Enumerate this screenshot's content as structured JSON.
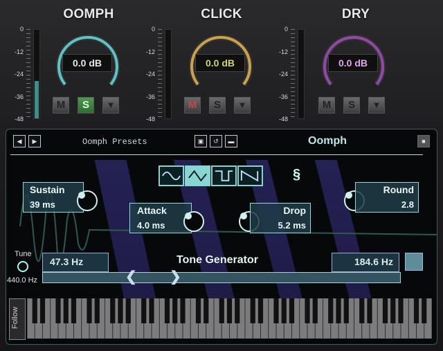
{
  "strips": [
    {
      "title": "OOMPH",
      "db": "0.0 dB",
      "db_color": "#e8e8e8",
      "arc_color": "#5bc4c4",
      "meter_level": 0.42,
      "buttons": {
        "m": "M",
        "s": "S",
        "arrow": "▼"
      },
      "m_state": "off",
      "s_state": "on"
    },
    {
      "title": "CLICK",
      "db": "0.0 dB",
      "db_color": "#d3d36c",
      "arc_color": "#c9a24b",
      "meter_level": 0,
      "buttons": {
        "m": "M",
        "s": "S",
        "arrow": "▼"
      },
      "m_state": "red",
      "s_state": "off"
    },
    {
      "title": "DRY",
      "db": "0.0 dB",
      "db_color": "#e2a8e6",
      "arc_color": "#9348a7",
      "meter_level": 0,
      "buttons": {
        "m": "M",
        "s": "S",
        "arrow": "▼"
      },
      "m_state": "off",
      "s_state": "off"
    }
  ],
  "meter_scale": [
    "0",
    "-12",
    "-24",
    "-36",
    "-48"
  ],
  "header": {
    "prev_icon": "triangle-left-icon",
    "next_icon": "triangle-right-icon",
    "preset_label": "Oomph Presets",
    "save_icon": "save-icon",
    "reset_icon": "reset-icon",
    "folder_icon": "folder-icon",
    "preset_name": "Oomph",
    "lock_icon": "lock-icon"
  },
  "waveforms": [
    {
      "icon": "sine-wave-icon",
      "selected": false
    },
    {
      "icon": "triangle-wave-icon",
      "selected": true
    },
    {
      "icon": "square-wave-icon",
      "selected": false
    },
    {
      "icon": "saw-wave-icon",
      "selected": false
    }
  ],
  "link_icon": "link-icon",
  "params": {
    "sustain": {
      "label": "Sustain",
      "value": "39 ms"
    },
    "attack": {
      "label": "Attack",
      "value": "4.0 ms"
    },
    "drop": {
      "label": "Drop",
      "value": "5.2 ms"
    },
    "round": {
      "label": "Round",
      "value": "2.8"
    }
  },
  "tune": {
    "label": "Tune",
    "value": "440.0 Hz"
  },
  "tone_generator": {
    "title": "Tone Generator",
    "low": "47.3 Hz",
    "high": "184.6 Hz",
    "left_arrow": "❮",
    "right_arrow": "❯"
  },
  "keyboard": {
    "follow_label": "Follow",
    "white_keys": 52
  }
}
